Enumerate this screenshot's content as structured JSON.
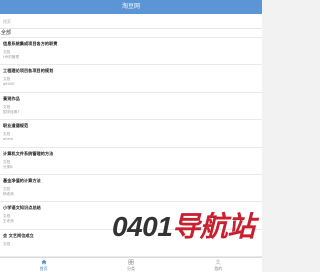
{
  "header": {
    "title": "淘豆网"
  },
  "search": {
    "placeholder": "搜索"
  },
  "filter": {
    "label": "全部"
  },
  "list": [
    {
      "title": "信息系统集成项目各方的职责",
      "source": "文档",
      "desc": "HR的管理"
    },
    {
      "title": "工程理论项目各项目的规划",
      "source": "文档",
      "desc": "q6000"
    },
    {
      "title": "景观作品",
      "source": "文档",
      "desc": "国学经典T"
    },
    {
      "title": "职业道德规范",
      "source": "文档",
      "desc": "ahem"
    },
    {
      "title": "计算机文件系统管理的方法",
      "source": "文档",
      "desc": "分类B"
    },
    {
      "title": "基金净值的计算方法",
      "source": "文档",
      "desc": "杨老师"
    },
    {
      "title": "小学语文知识点总结",
      "source": "文档",
      "desc": "王老师"
    },
    {
      "title": "会 文艺岗位成立",
      "source": "文档",
      "desc": ""
    }
  ],
  "watermark": {
    "digits": "0401",
    "cn": "导航站"
  },
  "brand_colors": {
    "header": "#5c95d6",
    "tab_active": "#4a86d0",
    "watermark_red": "#c8202e"
  },
  "tabbar": {
    "tabs": [
      {
        "label": "首页",
        "icon": "home-icon",
        "active": true
      },
      {
        "label": "分类",
        "icon": "grid-icon",
        "active": false
      },
      {
        "label": "我的",
        "icon": "user-icon",
        "active": false
      }
    ]
  }
}
